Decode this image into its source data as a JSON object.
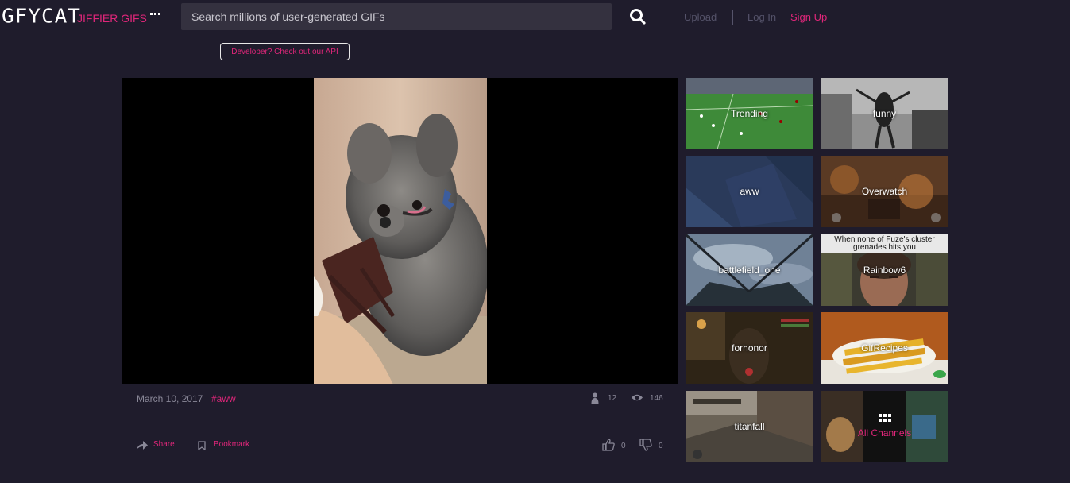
{
  "header": {
    "logo": "GFYCAT",
    "tagline": "JIFFIER GIFS",
    "more_icon": "ellipsis-icon",
    "search_placeholder": "Search millions of user-generated GIFs",
    "search_icon": "search-icon",
    "upload": "Upload",
    "login": "Log In",
    "signup": "Sign Up"
  },
  "dev_link": "Developer? Check out our API",
  "gif": {
    "date": "March 10, 2017",
    "tag": "#aww",
    "followers": "12",
    "views": "146",
    "likes": "0",
    "dislikes": "0",
    "share": "Share",
    "bookmark": "Bookmark"
  },
  "channels": [
    {
      "label": "Trending"
    },
    {
      "label": "funny"
    },
    {
      "label": "aww"
    },
    {
      "label": "Overwatch"
    },
    {
      "label": "battlefield_one"
    },
    {
      "label": "Rainbow6",
      "caption": "When none of Fuze's cluster grenades hits you"
    },
    {
      "label": "forhonor"
    },
    {
      "label": "GifRecipes"
    },
    {
      "label": "titanfall"
    },
    {
      "label": "All Channels"
    }
  ],
  "colors": {
    "background": "#1f1c2c",
    "accent": "#e0267a",
    "muted": "#55536a"
  }
}
